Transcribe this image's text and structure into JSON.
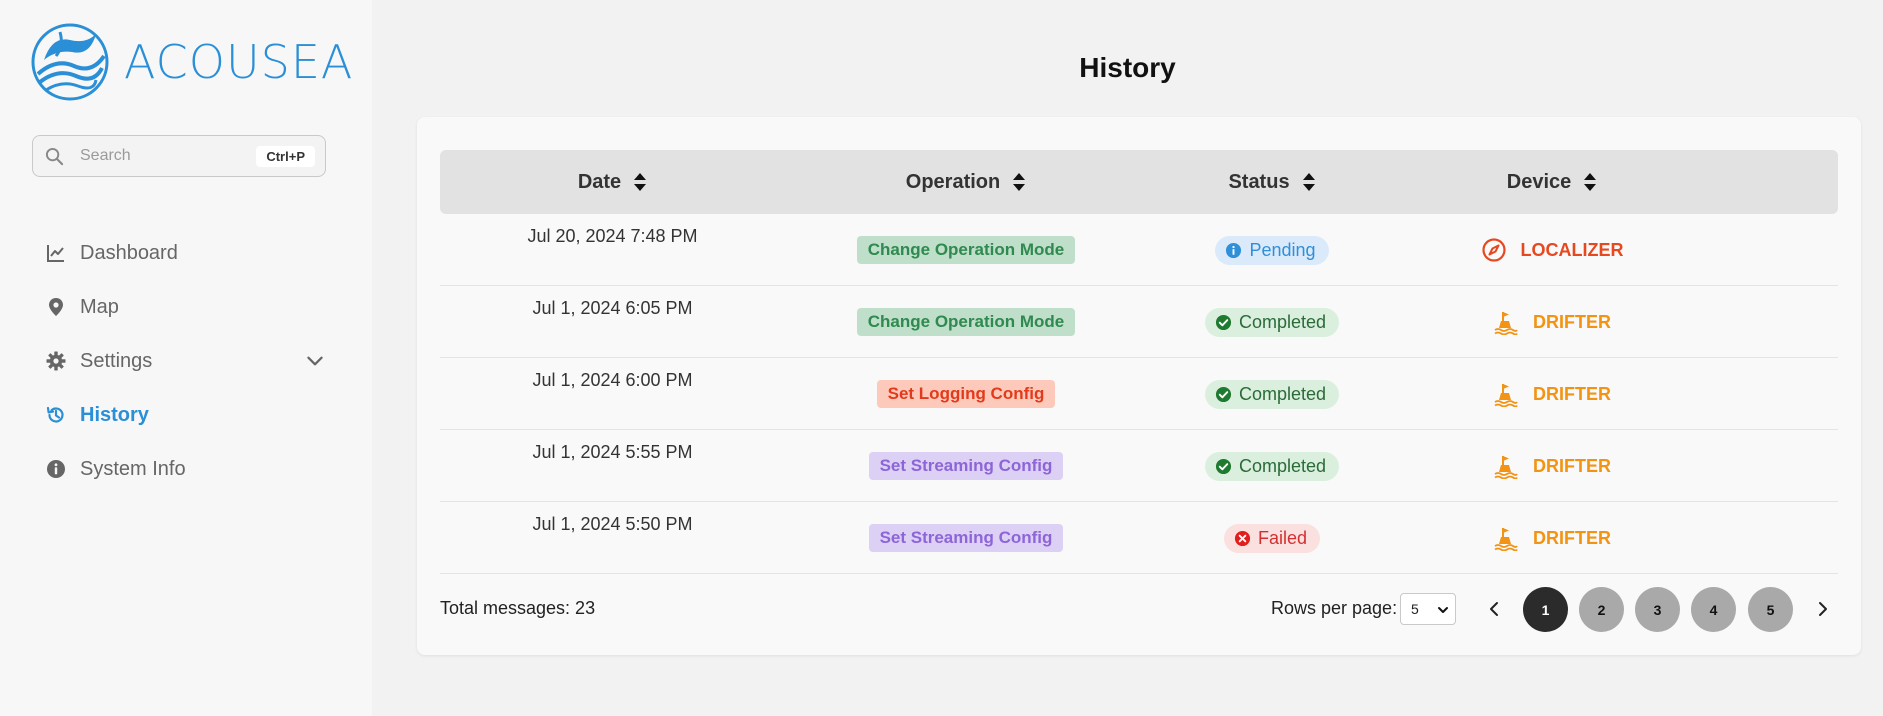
{
  "brand": {
    "name": "ACOUSEA"
  },
  "search": {
    "placeholder": "Search",
    "shortcut": "Ctrl+P"
  },
  "sidebar": {
    "items": [
      {
        "label": "Dashboard",
        "icon": "chart-line-icon",
        "active": false
      },
      {
        "label": "Map",
        "icon": "map-pin-icon",
        "active": false
      },
      {
        "label": "Settings",
        "icon": "gear-icon",
        "active": false,
        "expandable": true
      },
      {
        "label": "History",
        "icon": "history-icon",
        "active": true
      },
      {
        "label": "System Info",
        "icon": "info-circle-icon",
        "active": false
      }
    ]
  },
  "page": {
    "title": "History"
  },
  "table": {
    "columns": [
      "Date",
      "Operation",
      "Status",
      "Device"
    ],
    "rows": [
      {
        "date": "Jul 20, 2024 7:48 PM",
        "operation": "Change Operation Mode",
        "op_color": "green",
        "status": "Pending",
        "status_type": "pending",
        "device": "LOCALIZER",
        "device_icon": "compass-icon"
      },
      {
        "date": "Jul 1, 2024 6:05 PM",
        "operation": "Change Operation Mode",
        "op_color": "green",
        "status": "Completed",
        "status_type": "completed",
        "device": "DRIFTER",
        "device_icon": "buoy-icon"
      },
      {
        "date": "Jul 1, 2024 6:00 PM",
        "operation": "Set Logging Config",
        "op_color": "red",
        "status": "Completed",
        "status_type": "completed",
        "device": "DRIFTER",
        "device_icon": "buoy-icon"
      },
      {
        "date": "Jul 1, 2024 5:55 PM",
        "operation": "Set Streaming Config",
        "op_color": "purple",
        "status": "Completed",
        "status_type": "completed",
        "device": "DRIFTER",
        "device_icon": "buoy-icon"
      },
      {
        "date": "Jul 1, 2024 5:50 PM",
        "operation": "Set Streaming Config",
        "op_color": "purple",
        "status": "Failed",
        "status_type": "failed",
        "device": "DRIFTER",
        "device_icon": "buoy-icon"
      }
    ]
  },
  "footer": {
    "total_label": "Total messages: 23",
    "rows_per_page_label": "Rows per page:",
    "rows_per_page_value": "5",
    "pages": [
      "1",
      "2",
      "3",
      "4",
      "5"
    ],
    "current_page": "1"
  },
  "colors": {
    "accent": "#2a8fd6",
    "localizer": "#e6481f",
    "drifter": "#f39313"
  }
}
